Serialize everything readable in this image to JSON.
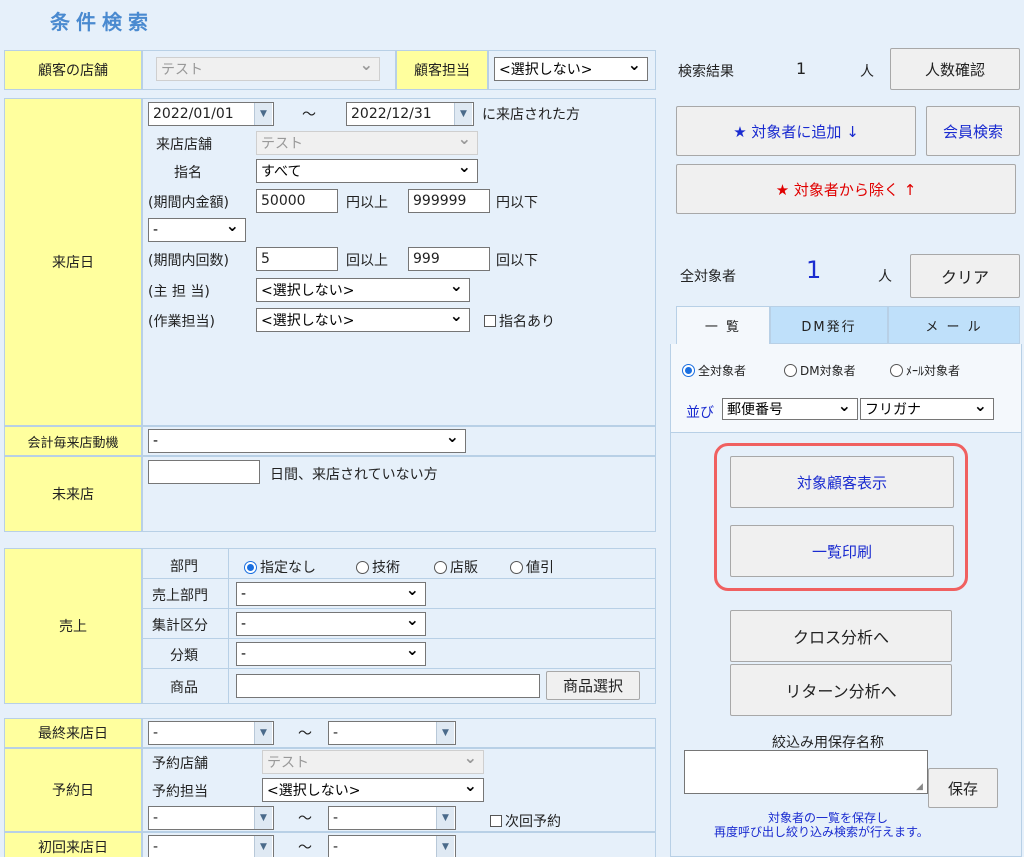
{
  "page_title": "条件検索",
  "shop": {
    "label": "顧客の店舗",
    "value": "テスト"
  },
  "staff": {
    "label": "顧客担当",
    "value": "<選択しない>"
  },
  "visit": {
    "label": "来店日",
    "date_from": "2022/01/01",
    "tilde": "～",
    "date_to": "2022/12/31",
    "suffix": "に来店された方",
    "shop_label": "来店店舗",
    "shop_value": "テスト",
    "nomination_label": "指名",
    "nomination_value": "すべて",
    "amount_label": "(期間内金額)",
    "amount_min": "50000",
    "amount_min_suffix": "円以上",
    "amount_max": "999999",
    "amount_max_suffix": "円以下",
    "op_value": "-",
    "count_label": "(期間内回数)",
    "count_min": "5",
    "count_min_suffix": "回以上",
    "count_max": "999",
    "count_max_suffix": "回以下",
    "main_staff_label": "(主 担 当)",
    "main_staff_value": "<選択しない>",
    "work_staff_label": "(作業担当)",
    "work_staff_value": "<選択しない>",
    "nominated_label": "指名あり"
  },
  "motive": {
    "label": "会計毎来店動機",
    "value": "-"
  },
  "not_visited": {
    "label": "未来店",
    "suffix": "日間、来店されていない方"
  },
  "sales": {
    "label": "売上",
    "dept_label": "部門",
    "radios": [
      "指定なし",
      "技術",
      "店販",
      "値引"
    ],
    "sales_dept_label": "売上部門",
    "sales_dept_value": "-",
    "agg_label": "集計区分",
    "agg_value": "-",
    "category_label": "分類",
    "category_value": "-",
    "product_label": "商品",
    "product_button": "商品選択"
  },
  "last_visit": {
    "label": "最終来店日",
    "from": "-",
    "tilde": "～",
    "to": "-"
  },
  "reservation": {
    "label": "予約日",
    "shop_label": "予約店舗",
    "shop_value": "テスト",
    "staff_label": "予約担当",
    "staff_value": "<選択しない>",
    "from": "-",
    "tilde": "～",
    "to": "-",
    "next_label": "次回予約"
  },
  "first_visit": {
    "label": "初回来店日",
    "from": "-",
    "tilde": "～",
    "to": "-"
  },
  "right": {
    "result_label": "検索結果",
    "result_count": "1",
    "unit": "人",
    "count_button": "人数確認",
    "add_button": "★ 対象者に追加 ↓",
    "member_button": "会員検索",
    "remove_button": "★ 対象者から除く ↑",
    "all_label": "全対象者",
    "all_count": "1",
    "clear_button": "クリア",
    "tabs": [
      "一 覧",
      "DM発行",
      "メ ー ル"
    ],
    "target_radios": [
      "全対象者",
      "DM対象者",
      "ﾒｰﾙ対象者"
    ],
    "sort_label": "並び",
    "sort1": "郵便番号",
    "sort2": "フリガナ",
    "show_button": "対象顧客表示",
    "print_button": "一覧印刷",
    "cross_button": "クロス分析へ",
    "return_button": "リターン分析へ",
    "save_name_label": "絞込み用保存名称",
    "save_button": "保存",
    "note_line1": "対象者の一覧を保存し",
    "note_line2": "再度呼び出し絞り込み検索が行えます。"
  },
  "colors": {
    "label_bg": "#ffff9e",
    "page_bg": "#e6f0fa",
    "highlight": "#f06060",
    "link_blue": "#1a2bd0",
    "red": "#e00000"
  }
}
